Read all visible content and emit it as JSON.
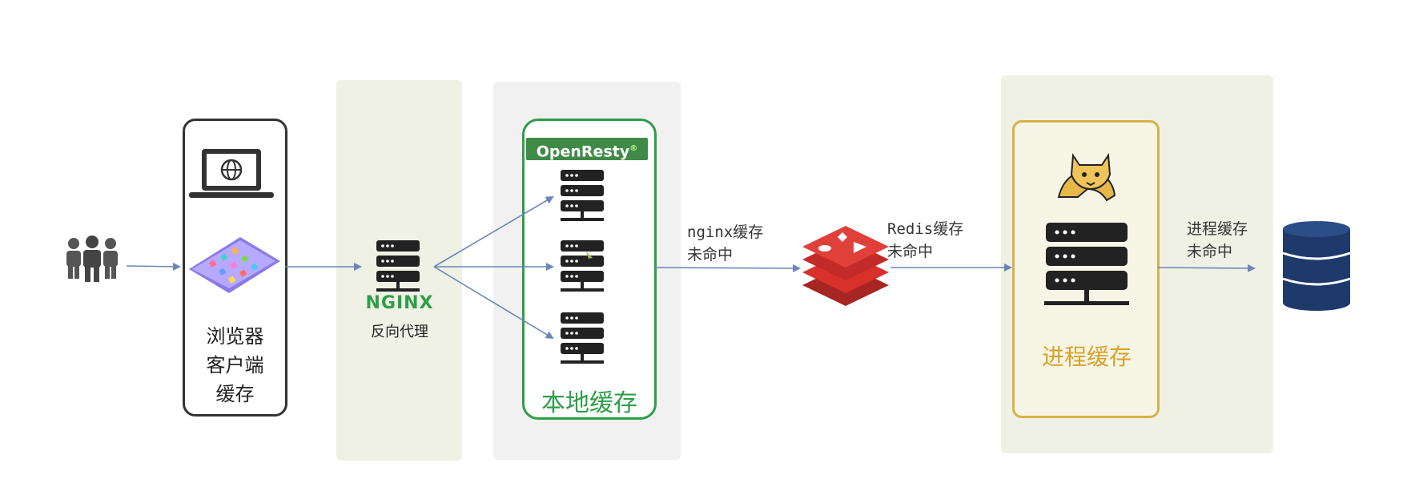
{
  "client": {
    "label_lines": [
      "浏览器",
      "客户端",
      "缓存"
    ]
  },
  "nginx": {
    "logo_text": "NGINX",
    "label": "反向代理"
  },
  "openresty": {
    "badge_text": "OpenResty",
    "badge_mark": "®",
    "label": "本地缓存"
  },
  "edges": {
    "nginx_miss": [
      "nginx缓存",
      "未命中"
    ],
    "redis_miss": [
      "Redis缓存",
      "未命中"
    ],
    "process_miss": [
      "进程缓存",
      "未命中"
    ]
  },
  "tomcat": {
    "label": "进程缓存"
  },
  "colors": {
    "nginx_zone": "#eef1e4",
    "openresty_zone": "#f1f1f1",
    "openresty_green": "#2e9e48",
    "tomcat_gold": "#d6b24a",
    "redis_red": "#d8312c",
    "db_navy": "#1e3a6b",
    "arrow": "#6b86b8",
    "server_dark": "#222222"
  },
  "icons": [
    "users-icon",
    "laptop-globe-icon",
    "phone-apps-icon",
    "server-icon",
    "redis-icon",
    "tomcat-icon",
    "database-icon"
  ]
}
